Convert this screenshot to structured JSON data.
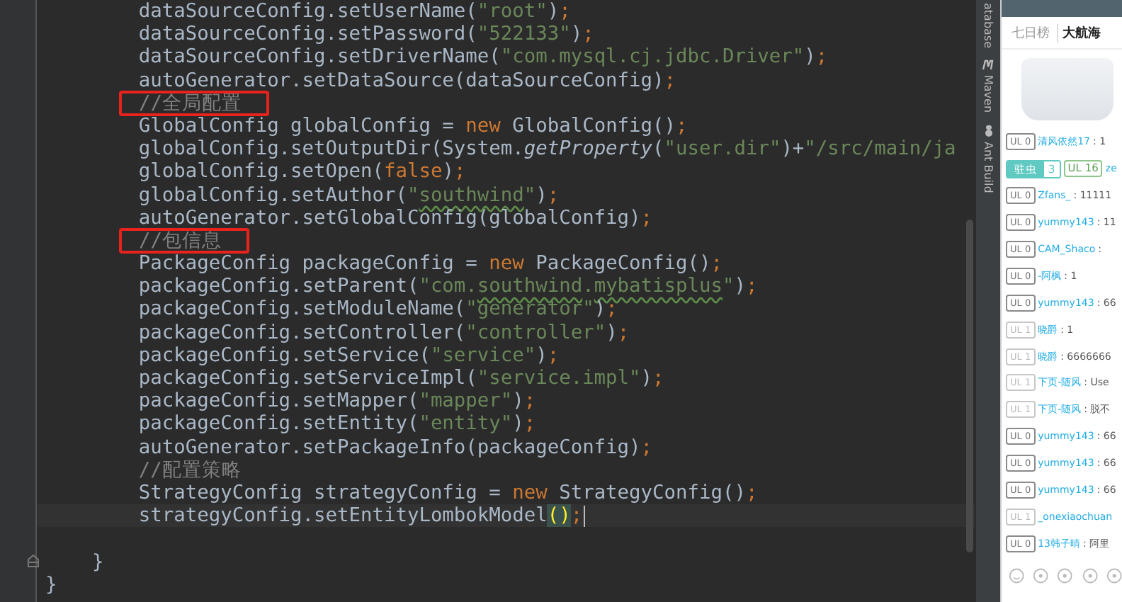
{
  "editor": {
    "lines": [
      {
        "tokens": [
          {
            "kind": "text",
            "text": "        dataSourceConfig.setUserName("
          },
          {
            "kind": "string",
            "text": "\"root\""
          },
          {
            "kind": "text",
            "text": ")"
          },
          {
            "kind": "semi",
            "text": ";"
          }
        ]
      },
      {
        "tokens": [
          {
            "kind": "text",
            "text": "        dataSourceConfig.setPassword("
          },
          {
            "kind": "string",
            "text": "\"522133\""
          },
          {
            "kind": "text",
            "text": ")"
          },
          {
            "kind": "semi",
            "text": ";"
          }
        ]
      },
      {
        "tokens": [
          {
            "kind": "text",
            "text": "        dataSourceConfig.setDriverName("
          },
          {
            "kind": "string",
            "text": "\"com.mysql.cj.jdbc.Driver\""
          },
          {
            "kind": "text",
            "text": ")"
          },
          {
            "kind": "semi",
            "text": ";"
          }
        ]
      },
      {
        "tokens": [
          {
            "kind": "text",
            "text": "        autoGenerator.setDataSource(dataSourceConfig)"
          },
          {
            "kind": "semi",
            "text": ";"
          }
        ]
      },
      {
        "boxed": true,
        "tokens": [
          {
            "kind": "comment",
            "text": "//全局配置"
          }
        ]
      },
      {
        "tokens": [
          {
            "kind": "text",
            "text": "        GlobalConfig globalConfig = "
          },
          {
            "kind": "keyword",
            "text": "new"
          },
          {
            "kind": "text",
            "text": " GlobalConfig()"
          },
          {
            "kind": "semi",
            "text": ";"
          }
        ]
      },
      {
        "tokens": [
          {
            "kind": "text",
            "text": "        globalConfig.setOutputDir(System."
          },
          {
            "kind": "static",
            "text": "getProperty"
          },
          {
            "kind": "text",
            "text": "("
          },
          {
            "kind": "string",
            "text": "\"user.dir\""
          },
          {
            "kind": "text",
            "text": ")+"
          },
          {
            "kind": "string",
            "text": "\"/src/main/ja"
          }
        ]
      },
      {
        "tokens": [
          {
            "kind": "text",
            "text": "        globalConfig.setOpen("
          },
          {
            "kind": "keyword",
            "text": "false"
          },
          {
            "kind": "text",
            "text": ")"
          },
          {
            "kind": "semi",
            "text": ";"
          }
        ]
      },
      {
        "tokens": [
          {
            "kind": "text",
            "text": "        globalConfig.setAuthor("
          },
          {
            "kind": "string",
            "text": "\""
          },
          {
            "kind": "typo",
            "text": "southwind"
          },
          {
            "kind": "string",
            "text": "\""
          },
          {
            "kind": "text",
            "text": ")"
          },
          {
            "kind": "semi",
            "text": ";"
          }
        ]
      },
      {
        "tokens": [
          {
            "kind": "text",
            "text": "        autoGenerator.setGlobalConfig(globalConfig)"
          },
          {
            "kind": "semi",
            "text": ";"
          }
        ]
      },
      {
        "boxed": true,
        "tokens": [
          {
            "kind": "comment",
            "text": "//包信息"
          }
        ]
      },
      {
        "tokens": [
          {
            "kind": "text",
            "text": "        PackageConfig packageConfig = "
          },
          {
            "kind": "keyword",
            "text": "new"
          },
          {
            "kind": "text",
            "text": " PackageConfig()"
          },
          {
            "kind": "semi",
            "text": ";"
          }
        ]
      },
      {
        "tokens": [
          {
            "kind": "text",
            "text": "        packageConfig.setParent("
          },
          {
            "kind": "string",
            "text": "\"com."
          },
          {
            "kind": "typo",
            "text": "southwind"
          },
          {
            "kind": "string",
            "text": "."
          },
          {
            "kind": "typo",
            "text": "mybatisplus"
          },
          {
            "kind": "string",
            "text": "\""
          },
          {
            "kind": "text",
            "text": ")"
          },
          {
            "kind": "semi",
            "text": ";"
          }
        ]
      },
      {
        "tokens": [
          {
            "kind": "text",
            "text": "        packageConfig.setModuleName("
          },
          {
            "kind": "string",
            "text": "\"generator\""
          },
          {
            "kind": "text",
            "text": ")"
          },
          {
            "kind": "semi",
            "text": ";"
          }
        ]
      },
      {
        "tokens": [
          {
            "kind": "text",
            "text": "        packageConfig.setController("
          },
          {
            "kind": "string",
            "text": "\"controller\""
          },
          {
            "kind": "text",
            "text": ")"
          },
          {
            "kind": "semi",
            "text": ";"
          }
        ]
      },
      {
        "tokens": [
          {
            "kind": "text",
            "text": "        packageConfig.setService("
          },
          {
            "kind": "string",
            "text": "\"service\""
          },
          {
            "kind": "text",
            "text": ")"
          },
          {
            "kind": "semi",
            "text": ";"
          }
        ]
      },
      {
        "tokens": [
          {
            "kind": "text",
            "text": "        packageConfig.setServiceImpl("
          },
          {
            "kind": "string",
            "text": "\"service.impl\""
          },
          {
            "kind": "text",
            "text": ")"
          },
          {
            "kind": "semi",
            "text": ";"
          }
        ]
      },
      {
        "tokens": [
          {
            "kind": "text",
            "text": "        packageConfig.setMapper("
          },
          {
            "kind": "string",
            "text": "\"mapper\""
          },
          {
            "kind": "text",
            "text": ")"
          },
          {
            "kind": "semi",
            "text": ";"
          }
        ]
      },
      {
        "tokens": [
          {
            "kind": "text",
            "text": "        packageConfig.setEntity("
          },
          {
            "kind": "string",
            "text": "\"entity\""
          },
          {
            "kind": "text",
            "text": ")"
          },
          {
            "kind": "semi",
            "text": ";"
          }
        ]
      },
      {
        "tokens": [
          {
            "kind": "text",
            "text": "        autoGenerator.setPackageInfo(packageConfig)"
          },
          {
            "kind": "semi",
            "text": ";"
          }
        ]
      },
      {
        "tokens": [
          {
            "kind": "comment",
            "text": "        //配置策略"
          }
        ]
      },
      {
        "tokens": [
          {
            "kind": "text",
            "text": "        StrategyConfig strategyConfig = "
          },
          {
            "kind": "keyword",
            "text": "new"
          },
          {
            "kind": "text",
            "text": " StrategyConfig()"
          },
          {
            "kind": "semi",
            "text": ";"
          }
        ]
      },
      {
        "current": true,
        "tokens": [
          {
            "kind": "text",
            "text": "        strategyConfig.setEntityLombokModel"
          },
          {
            "kind": "match",
            "text": "()"
          },
          {
            "kind": "semi",
            "text": ";"
          }
        ]
      },
      {
        "blank": true
      },
      {
        "fold": true,
        "tokens": [
          {
            "kind": "text",
            "text": "    }"
          }
        ]
      },
      {
        "tokens": [
          {
            "kind": "text",
            "text": "}"
          }
        ]
      }
    ]
  },
  "tool_strip": [
    {
      "kind": "database",
      "label": "atabase"
    },
    {
      "kind": "maven",
      "label": "Maven"
    },
    {
      "kind": "ant",
      "label": "Ant Build"
    }
  ],
  "chat": {
    "tabs": [
      {
        "label": "七日榜",
        "selected": false
      },
      {
        "label": "大航海",
        "selected": true
      }
    ],
    "messages": [
      {
        "kind": "plain",
        "badge": "UL 0",
        "muted": false,
        "user": "清风依然17",
        "text": ": 1"
      },
      {
        "kind": "fan",
        "medal": "驻虫",
        "medal_level": "3",
        "badge": "UL 16",
        "muted": false,
        "user": "ze"
      },
      {
        "kind": "plain",
        "badge": "UL 0",
        "muted": false,
        "user": "Zfans_",
        "text": ": 11111"
      },
      {
        "kind": "plain",
        "badge": "UL 0",
        "muted": false,
        "user": "yummy143",
        "text": ": 11"
      },
      {
        "kind": "plain",
        "badge": "UL 0",
        "muted": false,
        "user": "CAM_Shaco",
        "text": ":"
      },
      {
        "kind": "plain",
        "badge": "UL 0",
        "muted": false,
        "user": "-阿枫",
        "text": ": 1"
      },
      {
        "kind": "plain",
        "badge": "UL 0",
        "muted": false,
        "user": "yummy143",
        "text": ": 66"
      },
      {
        "kind": "plain",
        "badge": "UL 1",
        "muted": true,
        "user": "晓爵",
        "text": ": 1"
      },
      {
        "kind": "plain",
        "badge": "UL 1",
        "muted": true,
        "user": "晓爵",
        "text": ": 6666666"
      },
      {
        "kind": "plain",
        "badge": "UL 1",
        "muted": true,
        "user": "下页-随风",
        "text": ": Use"
      },
      {
        "kind": "plain",
        "badge": "UL 1",
        "muted": true,
        "user": "下页-随风",
        "text": ": 脱不"
      },
      {
        "kind": "plain",
        "badge": "UL 0",
        "muted": false,
        "user": "yummy143",
        "text": ": 66"
      },
      {
        "kind": "plain",
        "badge": "UL 0",
        "muted": false,
        "user": "yummy143",
        "text": ": 66"
      },
      {
        "kind": "plain",
        "badge": "UL 0",
        "muted": false,
        "user": "yummy143",
        "text": ": 66"
      },
      {
        "kind": "plain",
        "badge": "UL 1",
        "muted": true,
        "user": "_onexiaochuan"
      },
      {
        "kind": "plain",
        "badge": "UL 0",
        "muted": false,
        "user": "13韩子晴",
        "text": ": 阿里"
      }
    ]
  }
}
